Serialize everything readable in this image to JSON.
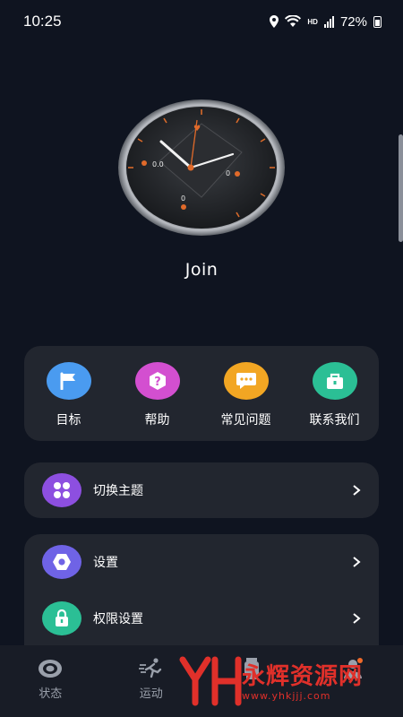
{
  "status": {
    "time": "10:25",
    "hd": "HD",
    "battery": "72%"
  },
  "watch": {
    "name": "Join",
    "face_readouts": [
      "0.0",
      "0",
      "0"
    ]
  },
  "quick_actions": [
    {
      "label": "目标",
      "icon": "flag-icon",
      "color": "#4a9bf0"
    },
    {
      "label": "帮助",
      "icon": "question-icon",
      "color": "#d34fd0"
    },
    {
      "label": "常见问题",
      "icon": "chat-bubble-icon",
      "color": "#f2a623"
    },
    {
      "label": "联系我们",
      "icon": "briefcase-icon",
      "color": "#2bbf95"
    }
  ],
  "menu": {
    "theme": {
      "label": "切换主题",
      "icon": "grid-icon",
      "color": "#8d4fe0"
    },
    "settings": {
      "label": "设置",
      "icon": "hexagon-nut-icon",
      "color": "#6f63e6"
    },
    "permissions": {
      "label": "权限设置",
      "icon": "lock-icon",
      "color": "#2bbf95"
    }
  },
  "tabs": [
    {
      "label": "状态",
      "icon": "eye-ring-icon"
    },
    {
      "label": "运动",
      "icon": "running-icon"
    },
    {
      "label": "",
      "icon": "watch-icon"
    }
  ],
  "watermark": {
    "logo": "YH",
    "text": "永辉资源网",
    "url": "www.yhkjjj.com"
  }
}
